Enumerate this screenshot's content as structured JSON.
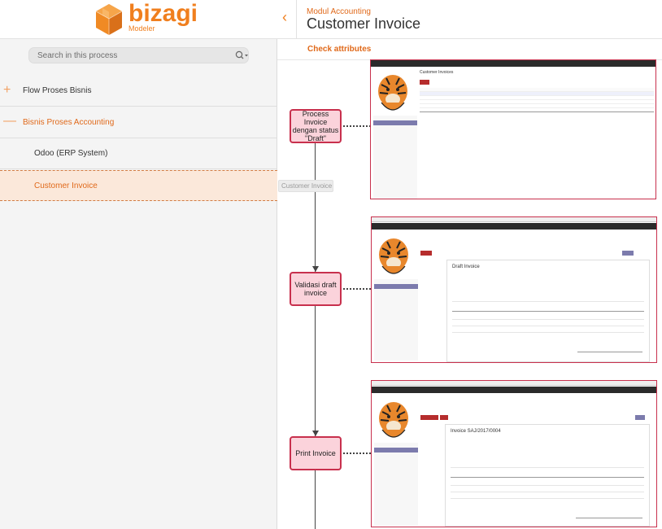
{
  "logo": {
    "word": "bizagi",
    "sub": "Modeler",
    "brand_color": "#f07f1e"
  },
  "search": {
    "placeholder": "Search in this process"
  },
  "tree": {
    "items": [
      {
        "sign": "+",
        "label": "Flow Proses Bisnis"
      },
      {
        "sign": "—",
        "label": "Bisnis Proses Accounting"
      },
      {
        "sign": "",
        "label": "Odoo (ERP System)"
      },
      {
        "sign": "",
        "label": "Customer Invoice"
      }
    ]
  },
  "header": {
    "subtitle": "Modul Accounting",
    "title": "Customer Invoice",
    "back": "‹"
  },
  "tabs": {
    "check": "Check attributes"
  },
  "tooltip": "Customer Invoice",
  "diagram": {
    "tasks": [
      {
        "label": "Process Invoice dengan status \"Draft\""
      },
      {
        "label": "Validasi draft invoice"
      },
      {
        "label": "Print Invoice"
      }
    ]
  },
  "shots": {
    "s1": {
      "title": "Customer Invoices"
    },
    "s2": {
      "title": "Draft Invoice"
    },
    "s3": {
      "title": "Invoice SAJ/2017/0004"
    }
  }
}
